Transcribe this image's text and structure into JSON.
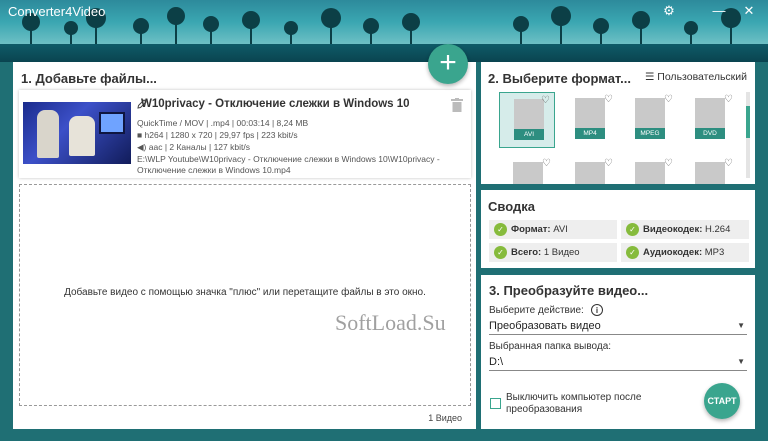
{
  "app": {
    "title": "Converter4Video"
  },
  "window": {
    "settings_icon": "gear-icon",
    "minimize_icon": "minimize-icon",
    "close_icon": "close-icon",
    "close_glyph": "✕",
    "minimize_glyph": "—"
  },
  "files_panel": {
    "title": "1. Добавьте файлы...",
    "add_icon": "+",
    "file": {
      "name": "W10privacy - Отключение слежки в Windows 10",
      "container_info": "QuickTime / MOV | .mp4 | 00:03:14 | 8,24 MB",
      "video_info": "h264 | 1280 x 720 | 29,97 fps | 223 kbit/s",
      "audio_info": "aac | 2 Каналы | 127 kbit/s",
      "path_line1": "E:\\WLP Youtube\\W10privacy - Отключение слежки в Windows 10\\W10privacy -",
      "path_line2": "Отключение слежки в Windows 10.mp4"
    },
    "drop_hint": "Добавьте видео с помощью значка \"плюс\" или перетащите файлы в это окно.",
    "count": "1 Видео",
    "watermark": "SoftLoad.Su"
  },
  "format_panel": {
    "title": "2. Выберите формат...",
    "custom_label": "Пользовательский",
    "formats": [
      {
        "label": "AVI",
        "selected": true
      },
      {
        "label": "MP4",
        "selected": false
      },
      {
        "label": "MPEG",
        "selected": false
      },
      {
        "label": "DVD",
        "selected": false
      }
    ],
    "scroll_position": 0.25
  },
  "summary_panel": {
    "title": "Сводка",
    "format_key": "Формат:",
    "format_val": "AVI",
    "vcodec_key": "Видеокодек:",
    "vcodec_val": "H.264",
    "total_key": "Всего:",
    "total_val": "1 Видео",
    "acodec_key": "Аудиокодек:",
    "acodec_val": "MP3"
  },
  "convert_panel": {
    "title": "3. Преобразуйте видео...",
    "action_label": "Выберите действие:",
    "action_value": "Преобразовать видео",
    "folder_label": "Выбранная папка вывода:",
    "folder_value": "D:\\",
    "shutdown_label": "Выключить компьютер после преобразования",
    "shutdown_checked": false,
    "start_label": "СТАРТ"
  },
  "colors": {
    "accent": "#3aa58e",
    "check": "#86bb3c",
    "background": "#1f6f74"
  }
}
